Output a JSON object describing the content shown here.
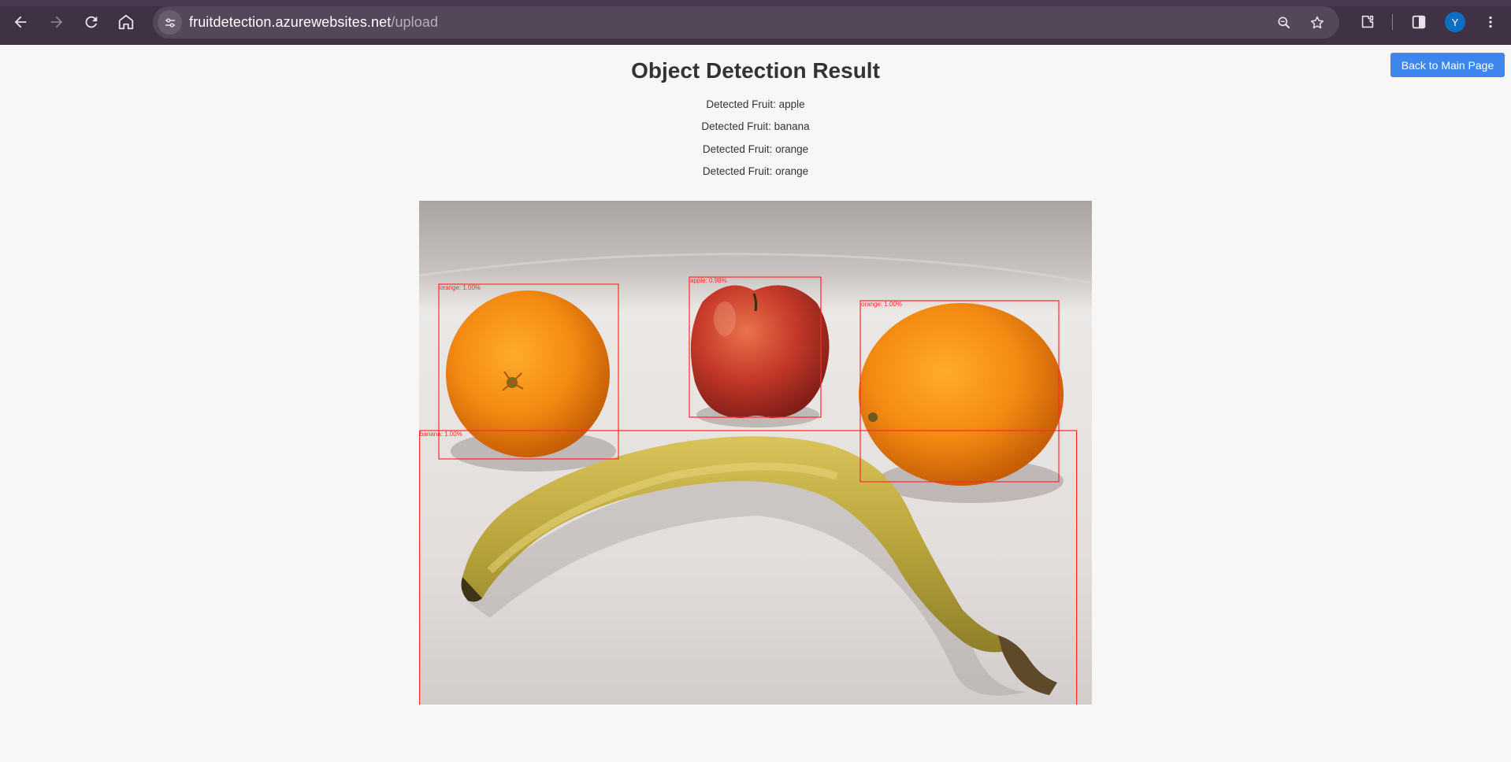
{
  "browser": {
    "url_host": "fruitdetection.azurewebsites.net",
    "url_path": "/upload",
    "profile_initial": "Y"
  },
  "page": {
    "title": "Object Detection Result",
    "back_button": "Back to Main Page",
    "detections_prefix": "Detected Fruit: ",
    "detections": [
      "Detected Fruit: apple",
      "Detected Fruit: banana",
      "Detected Fruit: orange",
      "Detected Fruit: orange"
    ]
  },
  "result_image": {
    "boxes": [
      {
        "label": "orange: 1.00%"
      },
      {
        "label": "apple: 0.98%"
      },
      {
        "label": "orange: 1.00%"
      },
      {
        "label": "banana: 1.00%"
      }
    ],
    "box_color": "#ff2a2a"
  },
  "colors": {
    "accent": "#3d86ee",
    "chrome_bg": "#3f3244"
  }
}
